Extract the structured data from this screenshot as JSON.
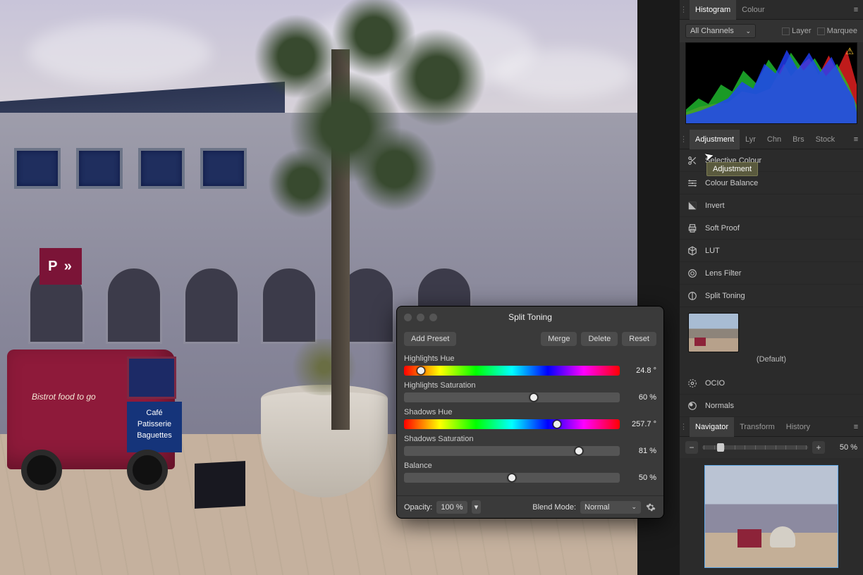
{
  "histogram_panel": {
    "tabs": [
      "Histogram",
      "Colour"
    ],
    "active_tab": "Histogram",
    "channel_selector": "All Channels",
    "checkbox_layer": "Layer",
    "checkbox_marquee": "Marquee"
  },
  "adjustment_panel": {
    "tabs": [
      "Adjustment",
      "Lyr",
      "Chn",
      "Brs",
      "Stock"
    ],
    "active_tab": "Adjustment",
    "tooltip": "Adjustment",
    "items": [
      {
        "label": "Selective Colour",
        "icon": "scissors"
      },
      {
        "label": "Colour Balance",
        "icon": "sliders"
      },
      {
        "label": "Invert",
        "icon": "invert"
      },
      {
        "label": "Soft Proof",
        "icon": "printer"
      },
      {
        "label": "LUT",
        "icon": "cube"
      },
      {
        "label": "Lens Filter",
        "icon": "lens"
      },
      {
        "label": "Split Toning",
        "icon": "split"
      }
    ],
    "preset_label": "(Default)",
    "extra_items": [
      {
        "label": "OCIO",
        "icon": "ocio"
      },
      {
        "label": "Normals",
        "icon": "normals"
      }
    ]
  },
  "navigator_panel": {
    "tabs": [
      "Navigator",
      "Transform",
      "History"
    ],
    "active_tab": "Navigator",
    "zoom_value": "50 %"
  },
  "dialog": {
    "title": "Split Toning",
    "add_preset": "Add Preset",
    "merge": "Merge",
    "delete": "Delete",
    "reset": "Reset",
    "params": {
      "highlights_hue": {
        "label": "Highlights Hue",
        "value": "24.8 °",
        "pos": 8,
        "type": "hue"
      },
      "highlights_sat": {
        "label": "Highlights Saturation",
        "value": "60 %",
        "pos": 60,
        "type": "gray"
      },
      "shadows_hue": {
        "label": "Shadows Hue",
        "value": "257.7 °",
        "pos": 71,
        "type": "hue"
      },
      "shadows_sat": {
        "label": "Shadows Saturation",
        "value": "81 %",
        "pos": 81,
        "type": "gray"
      },
      "balance": {
        "label": "Balance",
        "value": "50 %",
        "pos": 50,
        "type": "gray"
      }
    },
    "opacity_label": "Opacity:",
    "opacity_value": "100 %",
    "blend_label": "Blend Mode:",
    "blend_value": "Normal"
  },
  "photo": {
    "sign_p": "P »",
    "van_sign": "Bistrot food to go",
    "van_board_l1": "Café",
    "van_board_l2": "Patisserie",
    "van_board_l3": "Baguettes"
  }
}
